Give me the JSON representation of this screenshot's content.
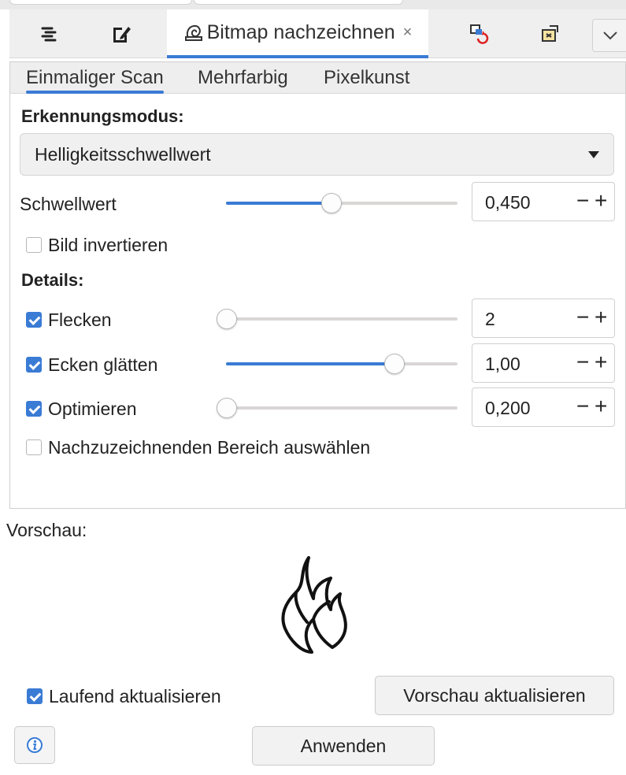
{
  "tabbar": {
    "active_tab_label": "Bitmap nachzeichnen",
    "close_symbol": "×",
    "icons": [
      "align-icon",
      "edit-document-icon",
      "trace-bitmap-icon",
      "swatch-undo-icon",
      "transform-icon",
      "chevron-down-icon"
    ]
  },
  "mode_tabs": {
    "single_scan": "Einmaliger Scan",
    "multicolor": "Mehrfarbig",
    "pixel_art": "Pixelkunst"
  },
  "detection": {
    "heading": "Erkennungsmodus:",
    "mode_value": "Helligkeitsschwellwert"
  },
  "threshold": {
    "label": "Schwellwert",
    "value": "0,450",
    "slider_fraction": 0.45
  },
  "invert": {
    "label": "Bild invertieren",
    "checked": false
  },
  "details": {
    "heading": "Details:",
    "speckles": {
      "label": "Flecken",
      "value": "2",
      "checked": true,
      "slider_fraction": 0.0
    },
    "smooth_corners": {
      "label": "Ecken glätten",
      "value": "1,00",
      "checked": true,
      "slider_fraction": 0.75
    },
    "optimize": {
      "label": "Optimieren",
      "value": "0,200",
      "checked": true,
      "slider_fraction": 0.0
    }
  },
  "area_select": {
    "label": "Nachzuzeichnenden Bereich auswählen",
    "checked": false
  },
  "preview": {
    "label": "Vorschau:",
    "live_update_label": "Laufend aktualisieren",
    "live_update_checked": true,
    "update_button": "Vorschau aktualisieren"
  },
  "footer": {
    "apply_button": "Anwenden",
    "info_icon": "info-icon"
  },
  "colors": {
    "accent": "#3a7bd5",
    "track": "#d9d6d6",
    "panel_border": "#cfcfcf"
  }
}
